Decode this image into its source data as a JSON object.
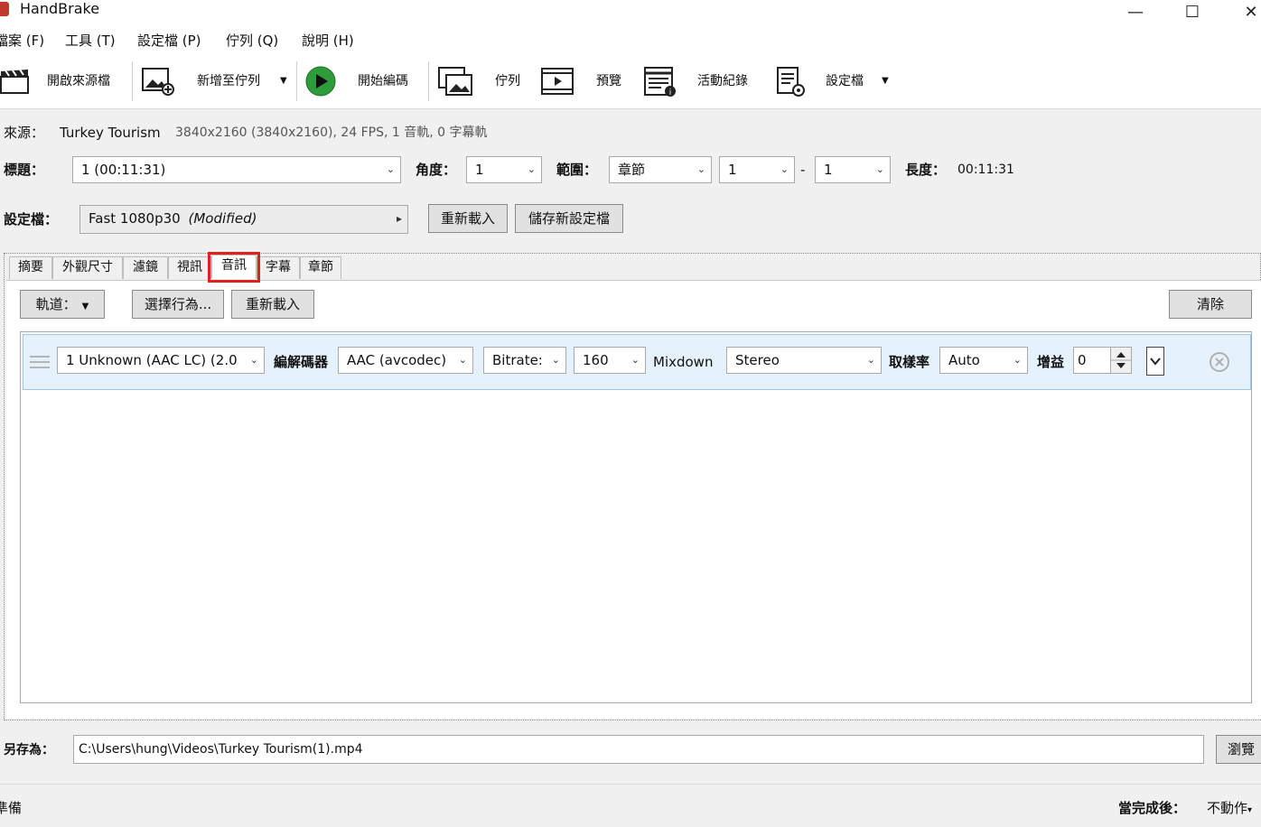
{
  "window": {
    "title": "HandBrake",
    "minimize": "—",
    "maximize": "☐",
    "close": "✕"
  },
  "menu": [
    "檔案 (F)",
    "工具 (T)",
    "設定檔 (P)",
    "佇列 (Q)",
    "說明 (H)"
  ],
  "toolbar": {
    "open_source": "開啟來源檔",
    "add_to_queue": "新增至佇列",
    "start_encode": "開始編碼",
    "queue": "佇列",
    "preview": "預覽",
    "activity_log": "活動紀錄",
    "presets": "設定檔"
  },
  "source": {
    "label": "來源：",
    "name": "Turkey Tourism",
    "details": "3840x2160 (3840x2160), 24 FPS, 1 音軌, 0 字幕軌"
  },
  "title_row": {
    "title_label": "標題：",
    "title_value": "1  (00:11:31)",
    "angle_label": "角度：",
    "angle_value": "1",
    "range_label": "範圍：",
    "range_type": "章節",
    "range_start": "1",
    "range_sep": "-",
    "range_end": "1",
    "duration_label": "長度：",
    "duration_value": "00:11:31"
  },
  "preset_row": {
    "label": "設定檔：",
    "preset_name": "Fast 1080p30",
    "preset_modified": "(Modified)",
    "reload": "重新載入",
    "save_new": "儲存新設定檔"
  },
  "tabs": [
    "摘要",
    "外觀尺寸",
    "濾鏡",
    "視訊",
    "音訊",
    "字幕",
    "章節"
  ],
  "audio": {
    "tracks_btn": "軌道：",
    "choose_behavior": "選擇行為...",
    "reload": "重新載入",
    "clear": "清除",
    "row": {
      "track": "1 Unknown (AAC LC) (2.0",
      "codec_label": "編解碼器",
      "codec": "AAC (avcodec)",
      "quality_mode": "Bitrate:",
      "bitrate": "160",
      "mixdown_label": "Mixdown",
      "mixdown": "Stereo",
      "samplerate_label": "取樣率",
      "samplerate": "Auto",
      "gain_label": "增益",
      "gain": "0"
    }
  },
  "save_as": {
    "label": "另存為：",
    "path": "C:\\Users\\hung\\Videos\\Turkey Tourism(1).mp4",
    "browse": "瀏覽"
  },
  "status": {
    "left": "準備",
    "when_done_label": "當完成後：",
    "when_done_value": "不動作"
  }
}
